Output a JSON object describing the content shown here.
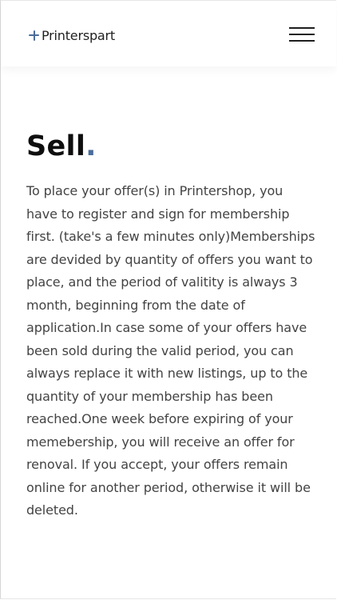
{
  "header": {
    "logo_text": "Printerspart",
    "logo_icon": "plus-icon",
    "menu_icon": "hamburger-menu-icon"
  },
  "main": {
    "title": "Sell",
    "title_dot": ".",
    "body": "To place your offer(s) in Printershop, you have to register and sign for membership first. (take's a few minutes only)Memberships are devided by quantity of offers you want to place, and the period of valitity is always 3 month, beginning from the date of application.In case some of your offers have been sold during the valid period, you can always replace it with new listings, up to the quantity of your membership has been reached.One week before expiring of your memebership, you will receive an offer for renoval. If you accept, your offers remain online for another period, otherwise it will be deleted."
  },
  "colors": {
    "accent": "#4a6d9a",
    "title": "#0e0e0e",
    "text": "#434343"
  }
}
